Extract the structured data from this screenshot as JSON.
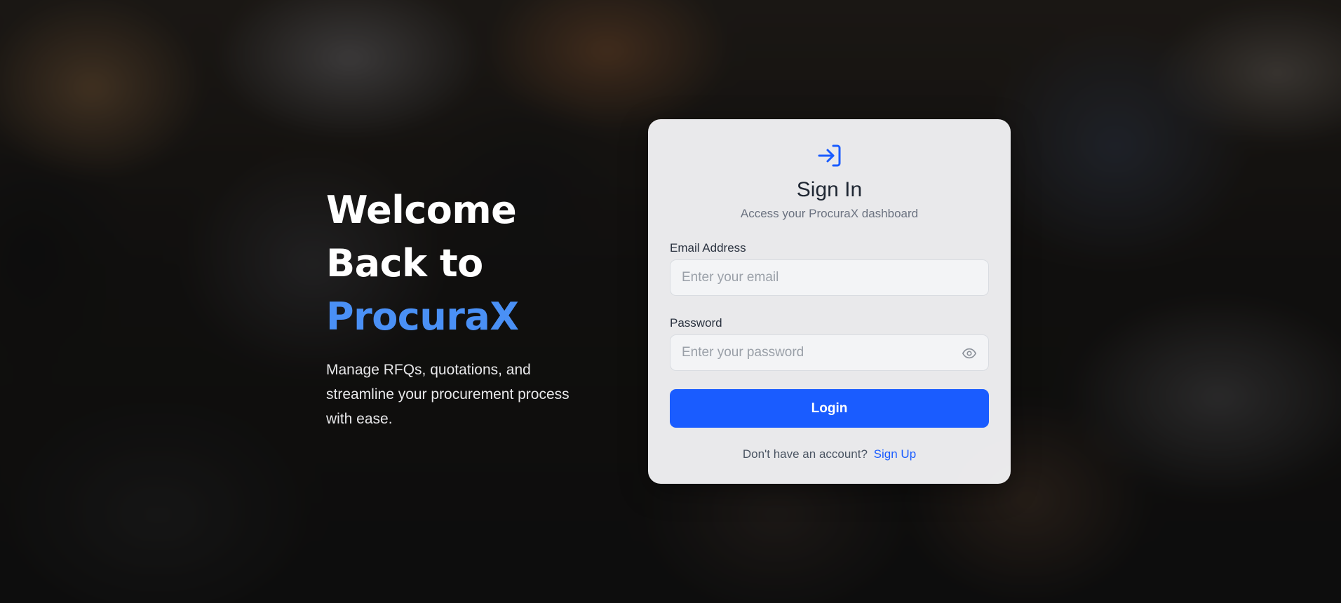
{
  "hero": {
    "title_line1": "Welcome",
    "title_line2": "Back to",
    "brand": "ProcuraX",
    "subtitle": "Manage RFQs, quotations, and streamline your procurement process with ease."
  },
  "card": {
    "icon": "sign-in-arrow-icon",
    "title": "Sign In",
    "subtitle": "Access your ProcuraX dashboard",
    "email": {
      "label": "Email Address",
      "placeholder": "Enter your email",
      "value": ""
    },
    "password": {
      "label": "Password",
      "placeholder": "Enter your password",
      "value": "",
      "toggle_icon": "eye-icon"
    },
    "login_label": "Login",
    "signup_prompt": "Don't have an account?",
    "signup_link": "Sign Up"
  },
  "colors": {
    "accent": "#1a5cff",
    "brand_text": "#4a90f5",
    "card_bg": "#f2f3f5"
  }
}
